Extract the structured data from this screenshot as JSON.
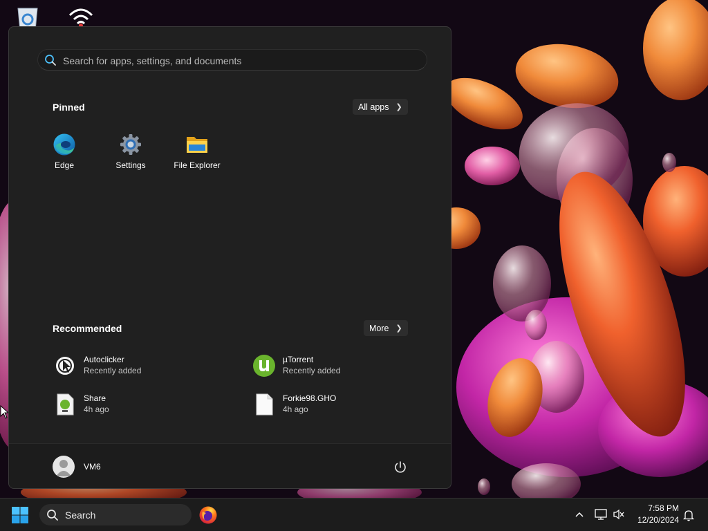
{
  "search": {
    "placeholder": "Search for apps, settings, and documents"
  },
  "pinned": {
    "title": "Pinned",
    "all_apps_label": "All apps",
    "apps": [
      {
        "label": "Edge",
        "icon": "edge-icon"
      },
      {
        "label": "Settings",
        "icon": "settings-gear-icon"
      },
      {
        "label": "File Explorer",
        "icon": "folder-icon"
      }
    ]
  },
  "recommended": {
    "title": "Recommended",
    "more_label": "More",
    "items": [
      {
        "name": "Autoclicker",
        "sub": "Recently added",
        "icon": "autoclicker-icon"
      },
      {
        "name": "µTorrent",
        "sub": "Recently added",
        "icon": "utorrent-icon"
      },
      {
        "name": "Share",
        "sub": "4h ago",
        "icon": "share-file-icon"
      },
      {
        "name": "Forkie98.GHO",
        "sub": "4h ago",
        "icon": "document-icon"
      }
    ]
  },
  "user": {
    "name": "VM6"
  },
  "taskbar": {
    "search_label": "Search",
    "time": "7:58 PM",
    "date": "12/20/2024"
  },
  "colors": {
    "menu_bg": "#202020",
    "taskbar_bg": "#1c1c1c",
    "accent": "#0078d4",
    "utorrent_green": "#6ab42d"
  }
}
